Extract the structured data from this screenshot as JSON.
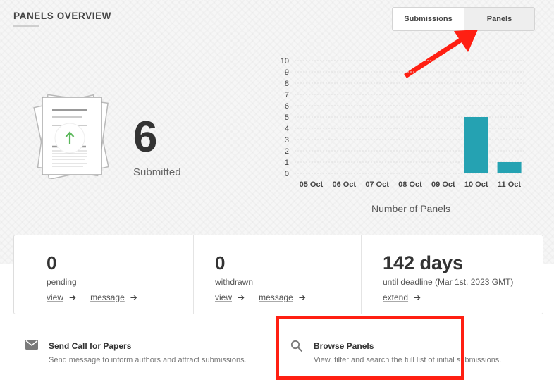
{
  "header": {
    "title": "PANELS OVERVIEW",
    "toggle": {
      "submissions_label": "Submissions",
      "panels_label": "Panels",
      "active": "Panels"
    }
  },
  "summary": {
    "count": "6",
    "label": "Submitted"
  },
  "chart_data": {
    "type": "bar",
    "categories": [
      "05 Oct",
      "06 Oct",
      "07 Oct",
      "08 Oct",
      "09 Oct",
      "10 Oct",
      "11 Oct"
    ],
    "values": [
      0,
      0,
      0,
      0,
      0,
      5,
      1
    ],
    "xlabel": "Number of Panels",
    "ylabel": "",
    "ylim": [
      0,
      10
    ],
    "yticks": [
      "0",
      "1",
      "2",
      "3",
      "4",
      "5",
      "6",
      "7",
      "8",
      "9",
      "10"
    ],
    "grid": true,
    "bar_color": "#25a2b2"
  },
  "stats": {
    "pending": {
      "value": "0",
      "label": "pending",
      "view": "view",
      "message": "message"
    },
    "withdrawn": {
      "value": "0",
      "label": "withdrawn",
      "view": "view",
      "message": "message"
    },
    "deadline": {
      "value": "142 days",
      "label": "until deadline (Mar 1st, 2023 GMT)",
      "extend": "extend"
    }
  },
  "actions": {
    "call": {
      "icon": "envelope-icon",
      "title": "Send Call for Papers",
      "description": "Send message to inform authors and attract submissions."
    },
    "browse": {
      "icon": "search-icon",
      "title": "Browse Panels",
      "description": "View, filter and search the full list of initial submissions."
    }
  },
  "colors": {
    "accent_bar": "#25a2b2",
    "annotation_red": "#ff1f12",
    "upload_green": "#5cb85c"
  }
}
